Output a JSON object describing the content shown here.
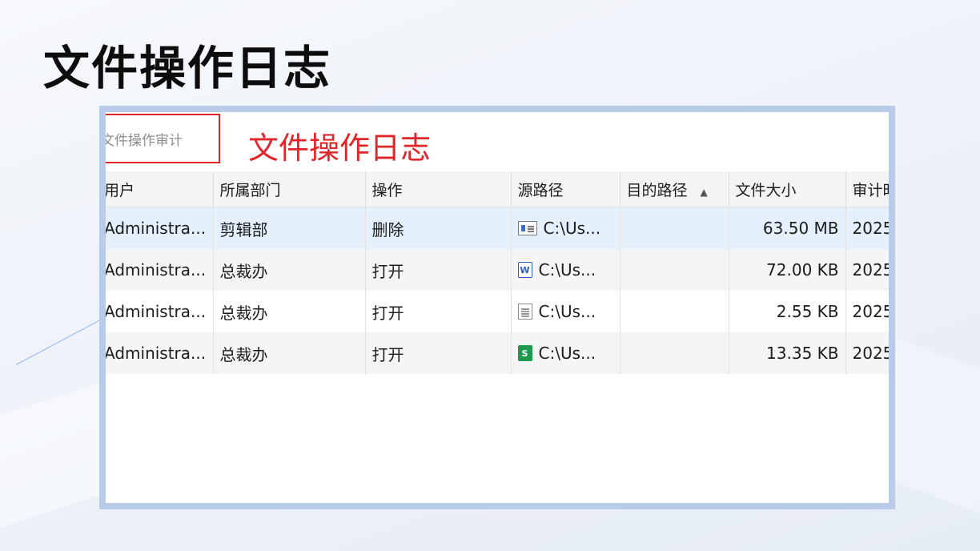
{
  "slide": {
    "title": "文件操作日志"
  },
  "audit_tab": {
    "label": "文件操作审计"
  },
  "annotation": {
    "text": "文件操作日志"
  },
  "columns": [
    {
      "label": "用户"
    },
    {
      "label": "所属部门"
    },
    {
      "label": "操作"
    },
    {
      "label": "源路径"
    },
    {
      "label": "目的路径",
      "sorted": "ascending"
    },
    {
      "label": "文件大小"
    },
    {
      "label": "审计时"
    }
  ],
  "rows": [
    {
      "user": "Administra...",
      "dept": "剪辑部",
      "action": "删除",
      "icon": "generic-file-icon",
      "src": "C:\\Us...",
      "dst": "",
      "size": "63.50 MB",
      "time": "2025"
    },
    {
      "user": "Administra...",
      "dept": "总裁办",
      "action": "打开",
      "icon": "word-doc-icon",
      "src": "C:\\Us...",
      "dst": "",
      "size": "72.00 KB",
      "time": "2025"
    },
    {
      "user": "Administra...",
      "dept": "总裁办",
      "action": "打开",
      "icon": "text-file-icon",
      "src": "C:\\Us...",
      "dst": "",
      "size": "2.55 KB",
      "time": "2025"
    },
    {
      "user": "Administra...",
      "dept": "总裁办",
      "action": "打开",
      "icon": "spreadsheet-icon",
      "src": "C:\\Us...",
      "dst": "",
      "size": "13.35 KB",
      "time": "2025"
    }
  ],
  "colors": {
    "accent_red": "#e0262b",
    "frame_blue": "#b9cbe8",
    "selected_row": "#e4f0fb",
    "header_bg": "#f4f4f4"
  }
}
